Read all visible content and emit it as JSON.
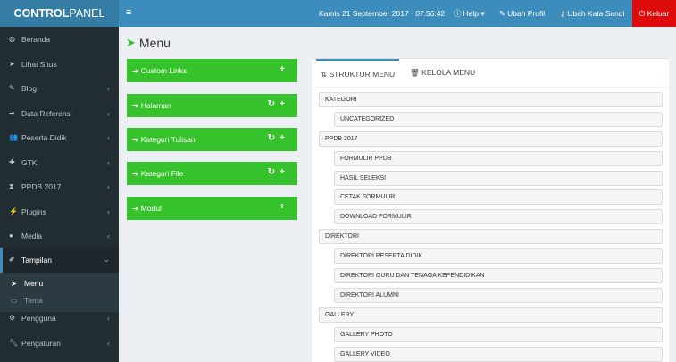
{
  "header": {
    "logo_bold": "CONTROL",
    "logo_rest": " PANEL",
    "datetime": "Kamis 21 September 2017 · 07:56:42",
    "help": "Help",
    "profile": "Ubah Profil",
    "password": "Ubah Kata Sandi",
    "logout": "Keluar"
  },
  "sidebar": {
    "items": [
      {
        "label": "Beranda",
        "icon": "dashboard-icon",
        "glyph": "◍",
        "chevron": ""
      },
      {
        "label": "Lihat Situs",
        "icon": "paper-plane-icon",
        "glyph": "➤",
        "chevron": ""
      },
      {
        "label": "Blog",
        "icon": "edit-icon",
        "glyph": "✎",
        "chevron": "‹"
      },
      {
        "label": "Data Referensi",
        "icon": "sign-in-icon",
        "glyph": "➜",
        "chevron": "‹"
      },
      {
        "label": "Peserta Didik",
        "icon": "users-icon",
        "glyph": "👥",
        "chevron": "‹"
      },
      {
        "label": "GTK",
        "icon": "user-plus-icon",
        "glyph": "✚",
        "chevron": "‹"
      },
      {
        "label": "PPDB 2017",
        "icon": "hourglass-icon",
        "glyph": "⧗",
        "chevron": "‹"
      },
      {
        "label": "Plugins",
        "icon": "plug-icon",
        "glyph": "⚡",
        "chevron": "‹"
      },
      {
        "label": "Media",
        "icon": "user-media-icon",
        "glyph": "●",
        "chevron": "‹"
      },
      {
        "label": "Tampilan",
        "icon": "paint-brush-icon",
        "glyph": "✐",
        "chevron": "⌄"
      }
    ],
    "submenu": [
      {
        "label": "Menu",
        "icon": "pointer-icon",
        "glyph": "▲"
      },
      {
        "label": "Tema",
        "icon": "desktop-icon",
        "glyph": "▭"
      }
    ],
    "bottom": [
      {
        "label": "Pengguna",
        "icon": "cogs-icon",
        "glyph": "⚙",
        "chevron": "‹"
      },
      {
        "label": "Pengaturan",
        "icon": "wrench-icon",
        "glyph": "✗",
        "chevron": "‹"
      }
    ]
  },
  "page": {
    "title": "Menu"
  },
  "modules": [
    {
      "label": "Custom Links",
      "refresh": false
    },
    {
      "label": "Halaman",
      "refresh": true
    },
    {
      "label": "Kategori Tulisan",
      "refresh": true
    },
    {
      "label": "Kategori File",
      "refresh": true
    },
    {
      "label": "Modul",
      "refresh": false
    }
  ],
  "tabs": {
    "structure": "STRUKTUR MENU",
    "manage": "KELOLA MENU"
  },
  "tree": [
    {
      "label": "KATEGORI",
      "level": 0
    },
    {
      "label": "UNCATEGORIZED",
      "level": 1
    },
    {
      "label": "PPDB 2017",
      "level": 0
    },
    {
      "label": "FORMULIR PPDB",
      "level": 1
    },
    {
      "label": "HASIL SELEKSI",
      "level": 1
    },
    {
      "label": "CETAK FORMULIR",
      "level": 1
    },
    {
      "label": "DOWNLOAD FORMULIR",
      "level": 1
    },
    {
      "label": "DIREKTORI",
      "level": 0
    },
    {
      "label": "DIREKTORI PESERTA DIDIK",
      "level": 1
    },
    {
      "label": "DIREKTORI GURU DAN TENAGA KEPENDIDIKAN",
      "level": 1
    },
    {
      "label": "DIREKTORI ALUMNI",
      "level": 1
    },
    {
      "label": "GALLERY",
      "level": 0
    },
    {
      "label": "GALLERY PHOTO",
      "level": 1
    },
    {
      "label": "GALLERY VIDEO",
      "level": 1
    }
  ],
  "colors": {
    "header": "#3c8dbc",
    "logo": "#357ca5",
    "sidebar": "#222d32",
    "module": "#36c22a",
    "logout": "#dd0b0b"
  }
}
